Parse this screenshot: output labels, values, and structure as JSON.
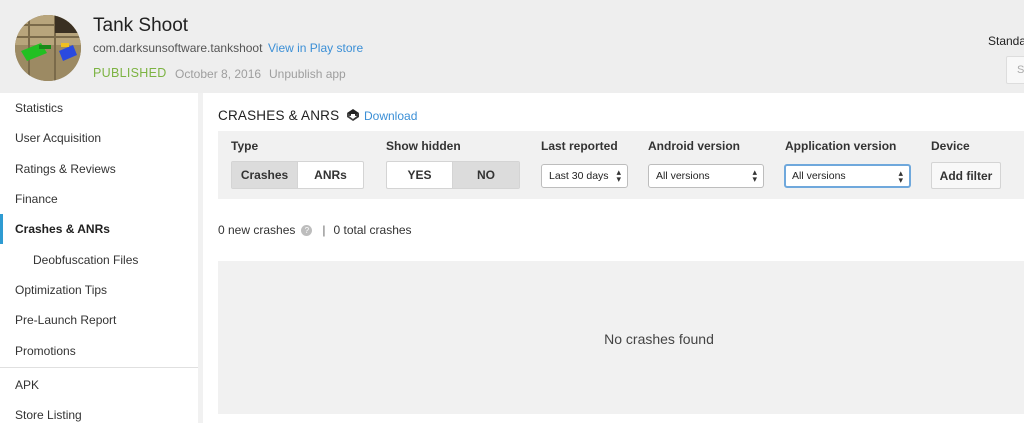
{
  "header": {
    "app_name": "Tank Shoot",
    "package": "com.darksunsoftware.tankshoot",
    "play_store_link": "View in Play store",
    "status": "PUBLISHED",
    "date": "October 8, 2016",
    "unpublish": "Unpublish app",
    "right_label": "Standa",
    "right_button": "S"
  },
  "sidebar": {
    "items": [
      {
        "label": "Statistics"
      },
      {
        "label": "User Acquisition"
      },
      {
        "label": "Ratings & Reviews"
      },
      {
        "label": "Finance"
      },
      {
        "label": "Crashes & ANRs"
      },
      {
        "label": "Deobfuscation Files"
      },
      {
        "label": "Optimization Tips"
      },
      {
        "label": "Pre-Launch Report"
      },
      {
        "label": "Promotions"
      }
    ],
    "bottom_items": [
      {
        "label": "APK"
      },
      {
        "label": "Store Listing"
      }
    ]
  },
  "main": {
    "title": "CRASHES & ANRS",
    "download": "Download",
    "filters": {
      "type_label": "Type",
      "type_options": [
        "Crashes",
        "ANRs"
      ],
      "hidden_label": "Show hidden",
      "hidden_options": [
        "YES",
        "NO"
      ],
      "reported_label": "Last reported",
      "reported_value": "Last 30 days",
      "android_label": "Android version",
      "android_value": "All versions",
      "app_label": "Application version",
      "app_value": "All versions",
      "device_label": "Device",
      "add_filter": "Add filter"
    },
    "summary": {
      "new_crashes": "0 new crashes",
      "help": "?",
      "separator": "|",
      "total_crashes": "0 total crashes"
    },
    "empty_message": "No crashes found"
  },
  "colors": {
    "accent_link": "#3b8fd6",
    "published": "#7cb342",
    "active_indicator": "#2e9bd2"
  }
}
